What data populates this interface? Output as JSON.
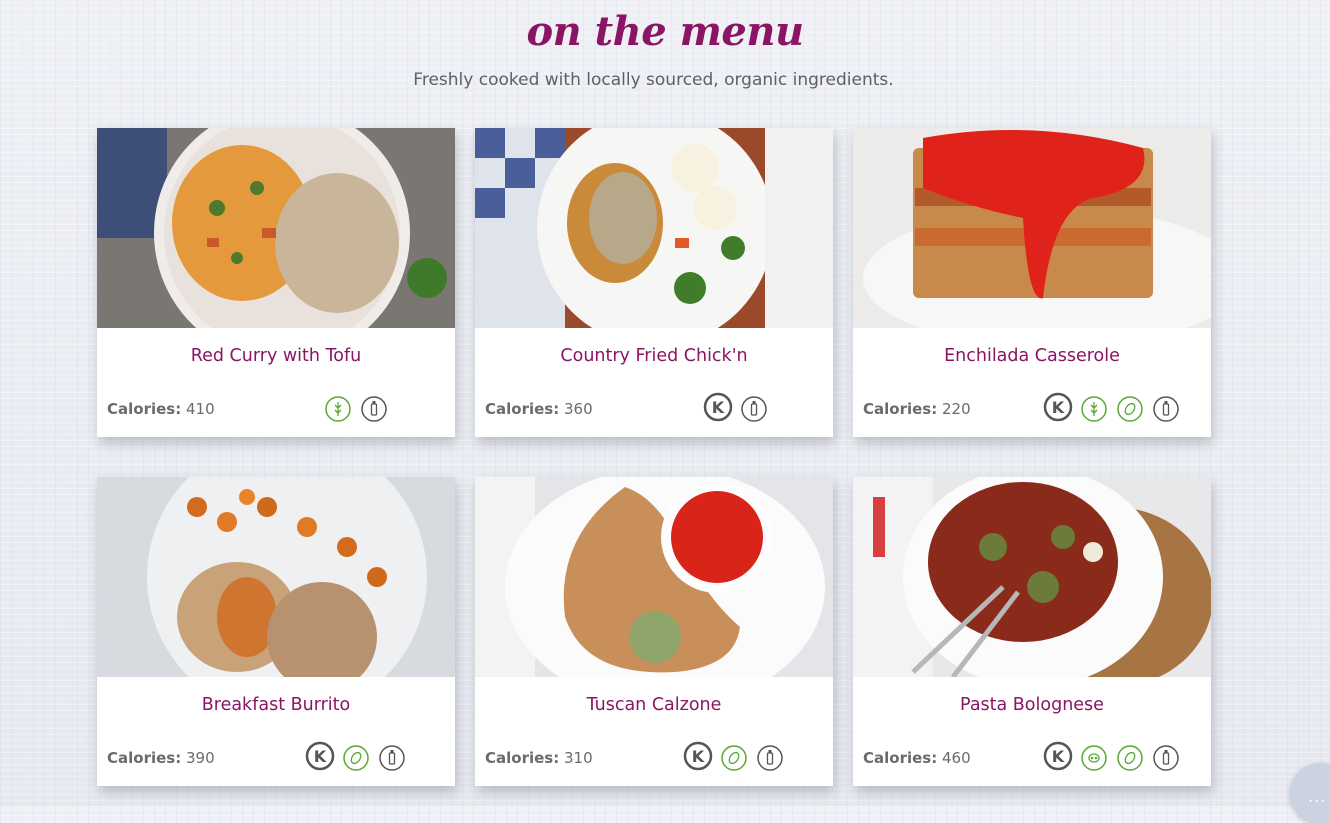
{
  "header": {
    "title": "on the menu",
    "subtitle": "Freshly cooked with locally sourced, organic ingredients."
  },
  "calories_label": "Calories:",
  "badge_text": {
    "gluten_free": "gluten-free",
    "dairy_free": "dairy-free",
    "nut_free": "nut-free",
    "soy_free": "soy-free",
    "kosher": "K"
  },
  "colors": {
    "brand": "#8a1565",
    "badge_green": "#5aa832",
    "badge_gray": "#555555"
  },
  "menu_items": [
    {
      "name": "Red Curry with Tofu",
      "calories": "410",
      "badges": [
        "gluten-free",
        "dairy-free"
      ]
    },
    {
      "name": "Country Fried Chick'n",
      "calories": "360",
      "badges": [
        "kosher",
        "dairy-free"
      ]
    },
    {
      "name": "Enchilada Casserole",
      "calories": "220",
      "badges": [
        "kosher",
        "gluten-free",
        "nut-free",
        "dairy-free"
      ]
    },
    {
      "name": "Breakfast Burrito",
      "calories": "390",
      "badges": [
        "kosher",
        "nut-free",
        "dairy-free"
      ]
    },
    {
      "name": "Tuscan Calzone",
      "calories": "310",
      "badges": [
        "kosher",
        "nut-free",
        "dairy-free"
      ]
    },
    {
      "name": "Pasta Bolognese",
      "calories": "460",
      "badges": [
        "kosher",
        "soy-free",
        "nut-free",
        "dairy-free"
      ]
    }
  ],
  "chat": {
    "icon": "chat-bubble-icon",
    "dots": "..."
  }
}
